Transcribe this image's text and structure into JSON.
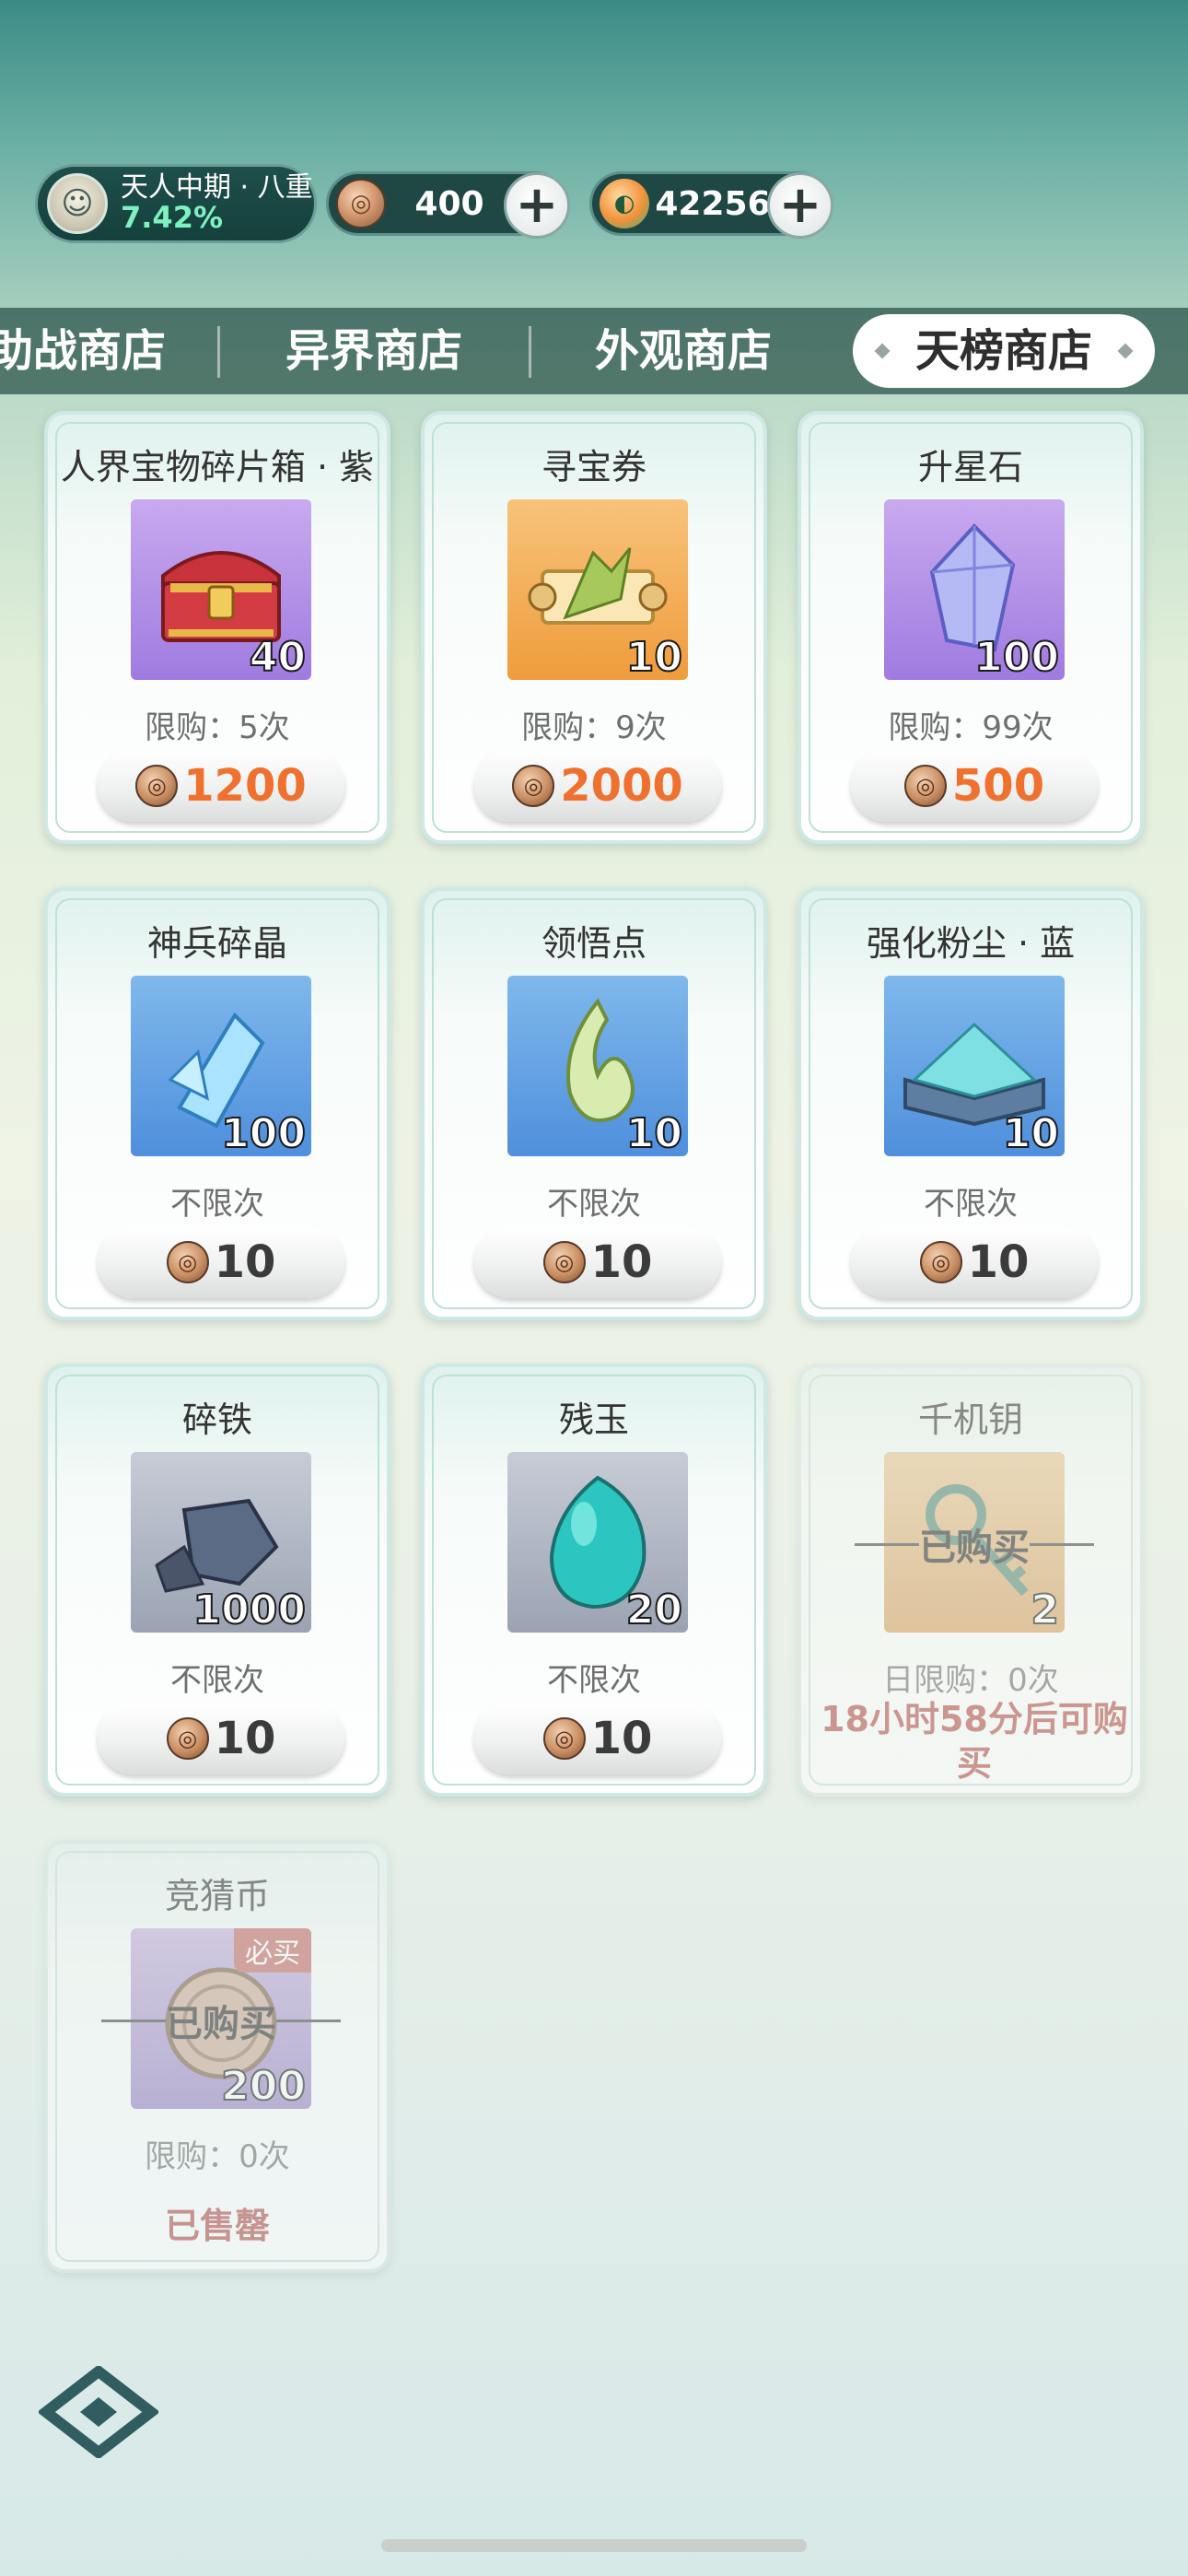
{
  "status": {
    "realm_name": "天人中期 · 八重",
    "realm_percent": "7.42%",
    "currency1_value": "400",
    "currency2_value": "42256"
  },
  "tabs": [
    {
      "label": "助战商店"
    },
    {
      "label": "异界商店"
    },
    {
      "label": "外观商店"
    },
    {
      "label": "天榜商店",
      "active": true
    }
  ],
  "items": [
    {
      "name": "人界宝物碎片箱 · 紫",
      "qty": "40",
      "limit": "限购：5次",
      "price": "1200",
      "icon": "treasure-chest-icon"
    },
    {
      "name": "寻宝券",
      "qty": "10",
      "limit": "限购：9次",
      "price": "2000",
      "icon": "scroll-ticket-icon"
    },
    {
      "name": "升星石",
      "qty": "100",
      "limit": "限购：99次",
      "price": "500",
      "icon": "crystal-icon"
    },
    {
      "name": "神兵碎晶",
      "qty": "100",
      "limit": "不限次",
      "price": "10",
      "icon": "ice-shard-icon"
    },
    {
      "name": "领悟点",
      "qty": "10",
      "limit": "不限次",
      "price": "10",
      "icon": "jade-swirl-icon"
    },
    {
      "name": "强化粉尘 · 蓝",
      "qty": "10",
      "limit": "不限次",
      "price": "10",
      "icon": "powder-box-icon"
    },
    {
      "name": "碎铁",
      "qty": "1000",
      "limit": "不限次",
      "price": "10",
      "icon": "iron-ore-icon"
    },
    {
      "name": "残玉",
      "qty": "20",
      "limit": "不限次",
      "price": "10",
      "icon": "jade-stone-icon"
    },
    {
      "name": "千机钥",
      "qty": "2",
      "limit": "日限购：0次",
      "bought": "已购买",
      "cooldown": "18小时58分后可购买",
      "icon": "key-icon"
    },
    {
      "name": "竞猜币",
      "qty": "200",
      "limit": "限购：0次",
      "bought": "已购买",
      "tag": "必买",
      "soldout": "已售罄",
      "icon": "coin-icon"
    }
  ],
  "colors": {
    "price_orange": "#f0712e",
    "alert_red": "#e0413b",
    "tab_bar": "#285048"
  }
}
